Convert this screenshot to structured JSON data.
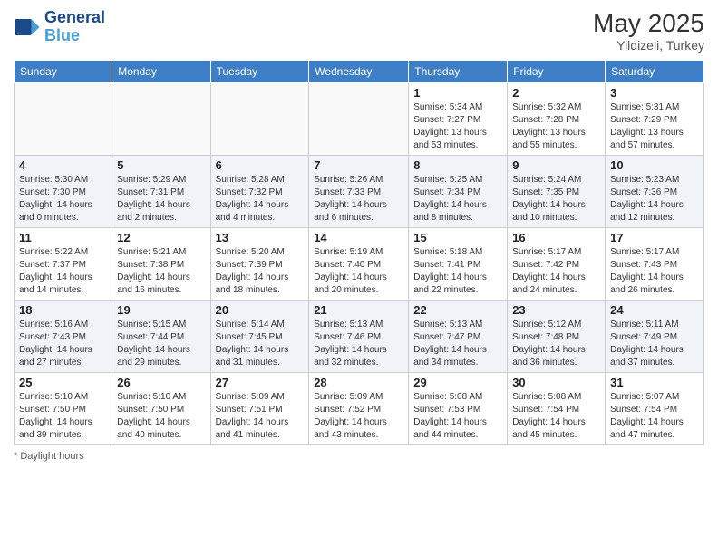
{
  "header": {
    "logo_line1": "General",
    "logo_line2": "Blue",
    "month": "May 2025",
    "location": "Yildizeli, Turkey"
  },
  "days_of_week": [
    "Sunday",
    "Monday",
    "Tuesday",
    "Wednesday",
    "Thursday",
    "Friday",
    "Saturday"
  ],
  "weeks": [
    [
      {
        "day": "",
        "info": ""
      },
      {
        "day": "",
        "info": ""
      },
      {
        "day": "",
        "info": ""
      },
      {
        "day": "",
        "info": ""
      },
      {
        "day": "1",
        "info": "Sunrise: 5:34 AM\nSunset: 7:27 PM\nDaylight: 13 hours\nand 53 minutes."
      },
      {
        "day": "2",
        "info": "Sunrise: 5:32 AM\nSunset: 7:28 PM\nDaylight: 13 hours\nand 55 minutes."
      },
      {
        "day": "3",
        "info": "Sunrise: 5:31 AM\nSunset: 7:29 PM\nDaylight: 13 hours\nand 57 minutes."
      }
    ],
    [
      {
        "day": "4",
        "info": "Sunrise: 5:30 AM\nSunset: 7:30 PM\nDaylight: 14 hours\nand 0 minutes."
      },
      {
        "day": "5",
        "info": "Sunrise: 5:29 AM\nSunset: 7:31 PM\nDaylight: 14 hours\nand 2 minutes."
      },
      {
        "day": "6",
        "info": "Sunrise: 5:28 AM\nSunset: 7:32 PM\nDaylight: 14 hours\nand 4 minutes."
      },
      {
        "day": "7",
        "info": "Sunrise: 5:26 AM\nSunset: 7:33 PM\nDaylight: 14 hours\nand 6 minutes."
      },
      {
        "day": "8",
        "info": "Sunrise: 5:25 AM\nSunset: 7:34 PM\nDaylight: 14 hours\nand 8 minutes."
      },
      {
        "day": "9",
        "info": "Sunrise: 5:24 AM\nSunset: 7:35 PM\nDaylight: 14 hours\nand 10 minutes."
      },
      {
        "day": "10",
        "info": "Sunrise: 5:23 AM\nSunset: 7:36 PM\nDaylight: 14 hours\nand 12 minutes."
      }
    ],
    [
      {
        "day": "11",
        "info": "Sunrise: 5:22 AM\nSunset: 7:37 PM\nDaylight: 14 hours\nand 14 minutes."
      },
      {
        "day": "12",
        "info": "Sunrise: 5:21 AM\nSunset: 7:38 PM\nDaylight: 14 hours\nand 16 minutes."
      },
      {
        "day": "13",
        "info": "Sunrise: 5:20 AM\nSunset: 7:39 PM\nDaylight: 14 hours\nand 18 minutes."
      },
      {
        "day": "14",
        "info": "Sunrise: 5:19 AM\nSunset: 7:40 PM\nDaylight: 14 hours\nand 20 minutes."
      },
      {
        "day": "15",
        "info": "Sunrise: 5:18 AM\nSunset: 7:41 PM\nDaylight: 14 hours\nand 22 minutes."
      },
      {
        "day": "16",
        "info": "Sunrise: 5:17 AM\nSunset: 7:42 PM\nDaylight: 14 hours\nand 24 minutes."
      },
      {
        "day": "17",
        "info": "Sunrise: 5:17 AM\nSunset: 7:43 PM\nDaylight: 14 hours\nand 26 minutes."
      }
    ],
    [
      {
        "day": "18",
        "info": "Sunrise: 5:16 AM\nSunset: 7:43 PM\nDaylight: 14 hours\nand 27 minutes."
      },
      {
        "day": "19",
        "info": "Sunrise: 5:15 AM\nSunset: 7:44 PM\nDaylight: 14 hours\nand 29 minutes."
      },
      {
        "day": "20",
        "info": "Sunrise: 5:14 AM\nSunset: 7:45 PM\nDaylight: 14 hours\nand 31 minutes."
      },
      {
        "day": "21",
        "info": "Sunrise: 5:13 AM\nSunset: 7:46 PM\nDaylight: 14 hours\nand 32 minutes."
      },
      {
        "day": "22",
        "info": "Sunrise: 5:13 AM\nSunset: 7:47 PM\nDaylight: 14 hours\nand 34 minutes."
      },
      {
        "day": "23",
        "info": "Sunrise: 5:12 AM\nSunset: 7:48 PM\nDaylight: 14 hours\nand 36 minutes."
      },
      {
        "day": "24",
        "info": "Sunrise: 5:11 AM\nSunset: 7:49 PM\nDaylight: 14 hours\nand 37 minutes."
      }
    ],
    [
      {
        "day": "25",
        "info": "Sunrise: 5:10 AM\nSunset: 7:50 PM\nDaylight: 14 hours\nand 39 minutes."
      },
      {
        "day": "26",
        "info": "Sunrise: 5:10 AM\nSunset: 7:50 PM\nDaylight: 14 hours\nand 40 minutes."
      },
      {
        "day": "27",
        "info": "Sunrise: 5:09 AM\nSunset: 7:51 PM\nDaylight: 14 hours\nand 41 minutes."
      },
      {
        "day": "28",
        "info": "Sunrise: 5:09 AM\nSunset: 7:52 PM\nDaylight: 14 hours\nand 43 minutes."
      },
      {
        "day": "29",
        "info": "Sunrise: 5:08 AM\nSunset: 7:53 PM\nDaylight: 14 hours\nand 44 minutes."
      },
      {
        "day": "30",
        "info": "Sunrise: 5:08 AM\nSunset: 7:54 PM\nDaylight: 14 hours\nand 45 minutes."
      },
      {
        "day": "31",
        "info": "Sunrise: 5:07 AM\nSunset: 7:54 PM\nDaylight: 14 hours\nand 47 minutes."
      }
    ]
  ],
  "footer": {
    "daylight_label": "Daylight hours"
  }
}
